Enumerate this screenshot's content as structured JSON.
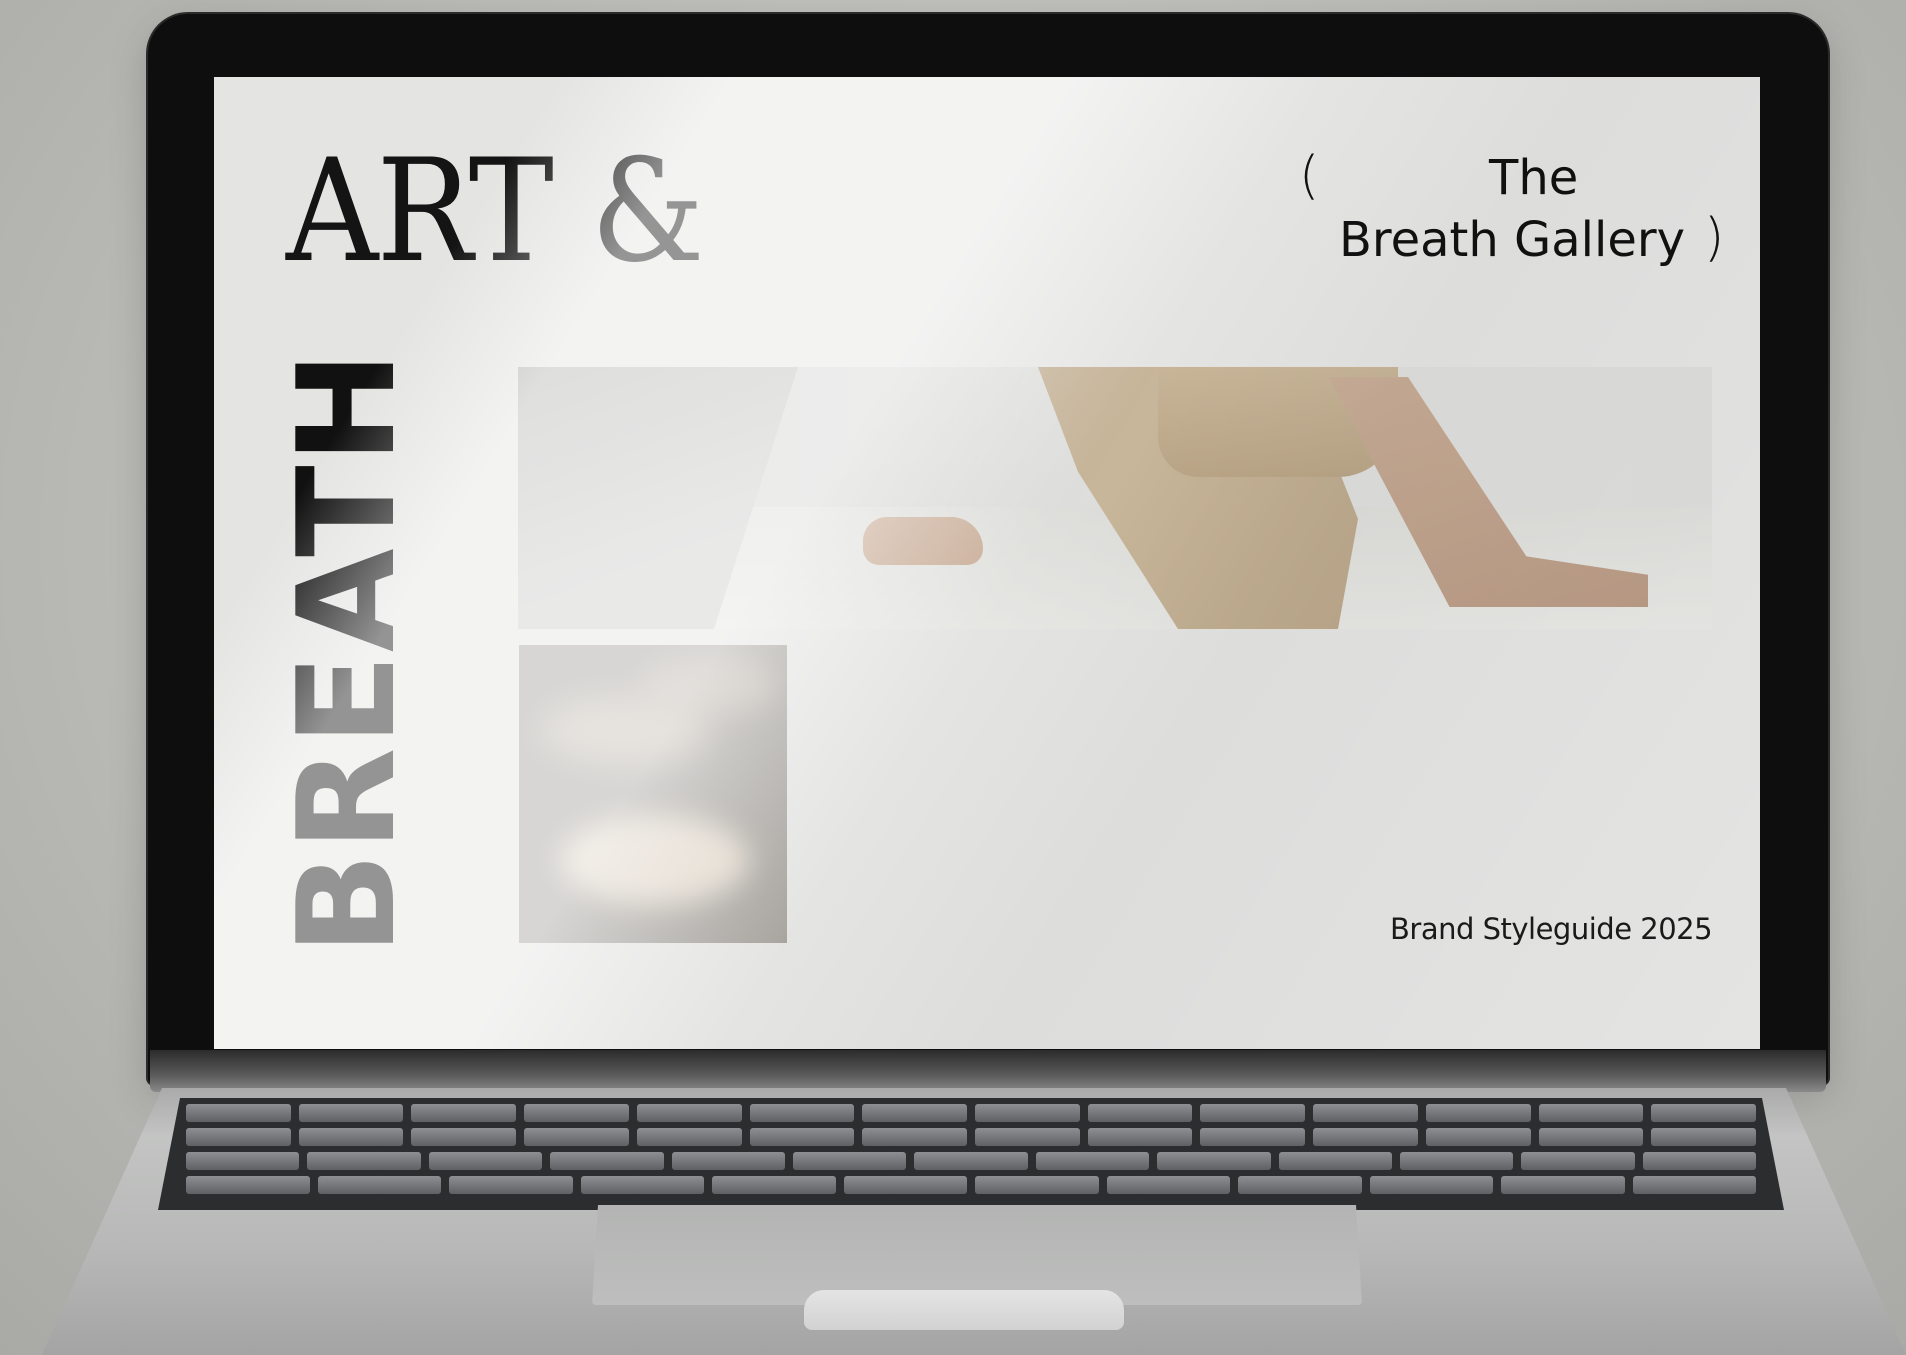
{
  "screen": {
    "title_serif": "ART &",
    "title_vertical": "BREATH",
    "gallery": {
      "paren_open": "(",
      "line1": "The",
      "line2": "Breath Gallery",
      "paren_close": ")"
    },
    "footer_text": "Brand Styleguide 2025",
    "images": {
      "wide": "person seated on floor in beige activewear",
      "square": "soft light reflections on wall"
    }
  },
  "colors": {
    "screen_background": "#e4e4e3",
    "text": "#111111",
    "bezel": "#0e0e0e",
    "laptop_body": "#b7b8b7"
  }
}
